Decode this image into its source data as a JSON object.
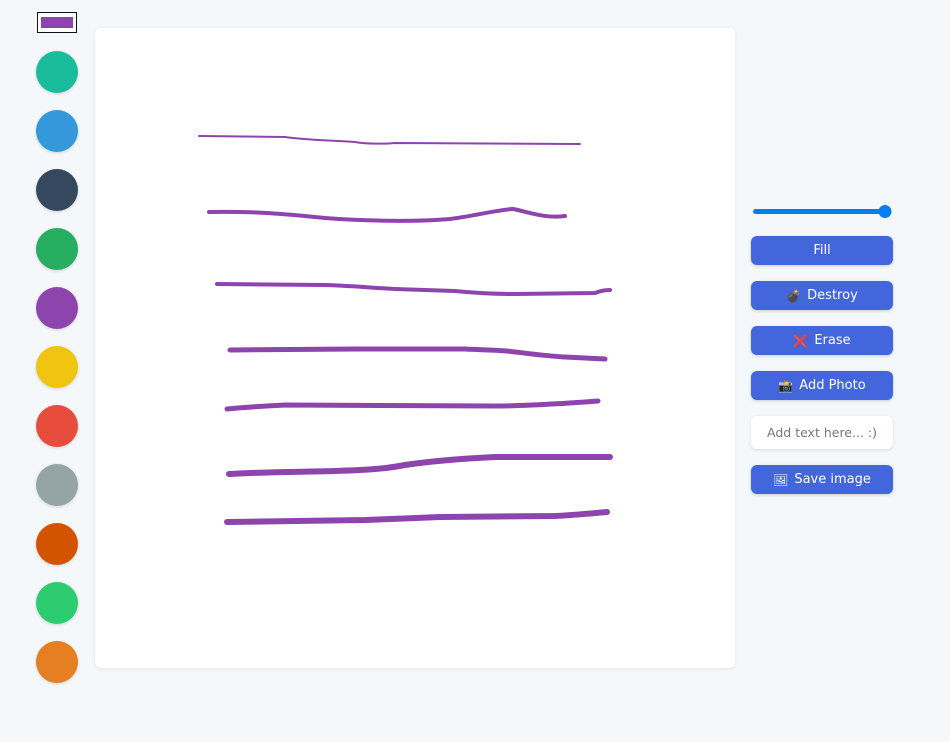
{
  "current_color": "#8e44ad",
  "palette": [
    {
      "name": "turquoise",
      "color": "#1abc9c"
    },
    {
      "name": "blue",
      "color": "#3498db"
    },
    {
      "name": "dark-navy",
      "color": "#34495e"
    },
    {
      "name": "green",
      "color": "#27ae60"
    },
    {
      "name": "purple",
      "color": "#8e44ad"
    },
    {
      "name": "yellow",
      "color": "#f1c40f"
    },
    {
      "name": "red",
      "color": "#e74c3c"
    },
    {
      "name": "gray",
      "color": "#95a5a6"
    },
    {
      "name": "dark-orange",
      "color": "#d35400"
    },
    {
      "name": "emerald",
      "color": "#2ecc71"
    },
    {
      "name": "orange",
      "color": "#e67e22"
    }
  ],
  "brush_size_fraction": 1.0,
  "buttons": {
    "fill": {
      "label": "Fill",
      "icon": ""
    },
    "destroy": {
      "label": "Destroy",
      "icon": "💣"
    },
    "erase": {
      "label": "Erase",
      "icon": "❌"
    },
    "add_photo": {
      "label": "Add Photo",
      "icon": "📸"
    },
    "save_image": {
      "label": "Save image",
      "icon": "🖼"
    }
  },
  "text_input": {
    "value": "",
    "placeholder": "Add text here... :)"
  },
  "accent_color": "#4466dd",
  "slider_color": "#0a7cf2"
}
